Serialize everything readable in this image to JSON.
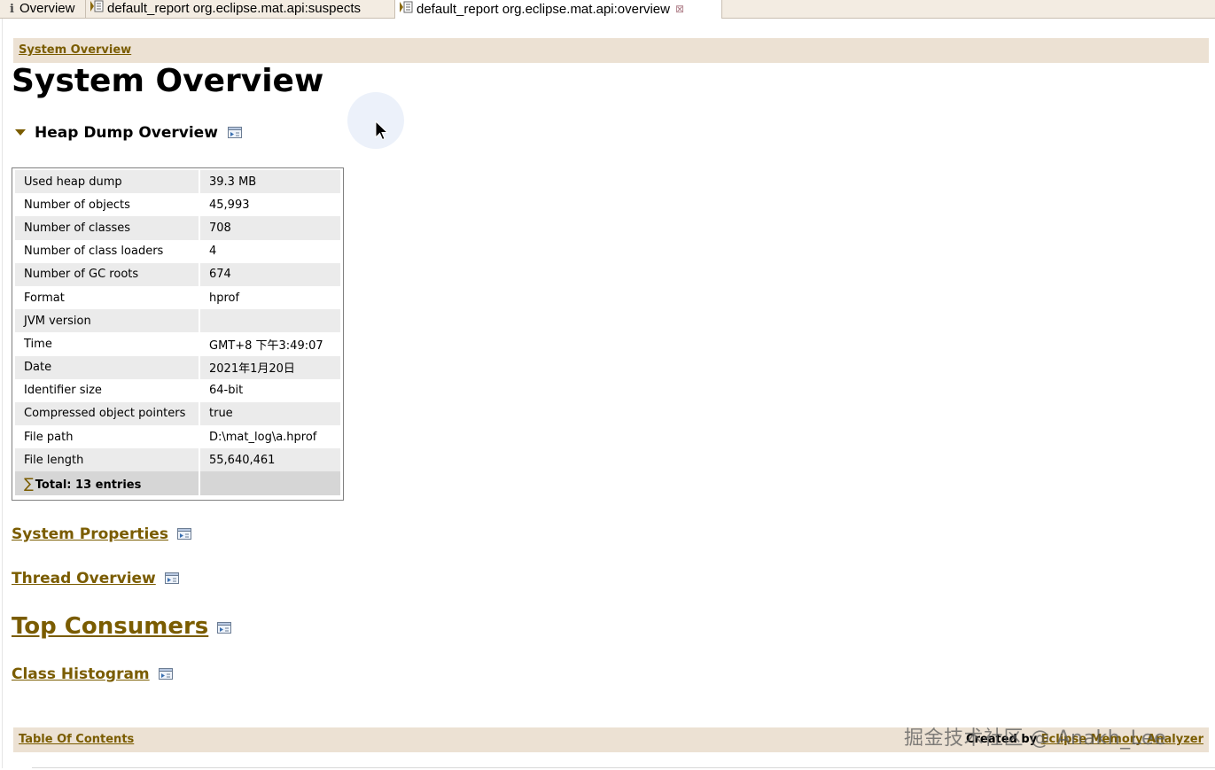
{
  "tabs": [
    {
      "label": "Overview",
      "icon": "info-icon"
    },
    {
      "label": "default_report  org.eclipse.mat.api:suspects",
      "icon": "report-icon"
    },
    {
      "label": "default_report  org.eclipse.mat.api:overview",
      "icon": "report-icon",
      "active": true,
      "close_glyph": "⊠"
    }
  ],
  "breadcrumb": "System Overview",
  "page_title": "System Overview",
  "heap_section": {
    "title": "Heap Dump Overview",
    "rows": [
      {
        "label": "Used heap dump",
        "value": "39.3 MB"
      },
      {
        "label": "Number of objects",
        "value": "45,993"
      },
      {
        "label": "Number of classes",
        "value": "708"
      },
      {
        "label": "Number of class loaders",
        "value": "4"
      },
      {
        "label": "Number of GC roots",
        "value": "674"
      },
      {
        "label": "Format",
        "value": "hprof"
      },
      {
        "label": "JVM version",
        "value": ""
      },
      {
        "label": "Time",
        "value": "GMT+8 下午3:49:07"
      },
      {
        "label": "Date",
        "value": "2021年1月20日"
      },
      {
        "label": "Identifier size",
        "value": "64-bit"
      },
      {
        "label": "Compressed object pointers",
        "value": "true"
      },
      {
        "label": "File path",
        "value": "D:\\mat_log\\a.hprof"
      },
      {
        "label": "File length",
        "value": "55,640,461"
      }
    ],
    "total_symbol": "∑",
    "total_label": "Total: 13 entries"
  },
  "links": {
    "system_properties": "System Properties",
    "thread_overview": "Thread Overview",
    "top_consumers": "Top Consumers",
    "class_histogram": "Class Histogram"
  },
  "footer": {
    "toc": "Table Of Contents",
    "created_by": "Created by",
    "analyzer_link": "Eclipse Memory Analyzer"
  },
  "watermark": "掘金技术社区 @ Anakh_Lee",
  "colors": {
    "link": "#7a5c00",
    "bar": "#ece1d3",
    "row_alt": "#ebebeb"
  }
}
